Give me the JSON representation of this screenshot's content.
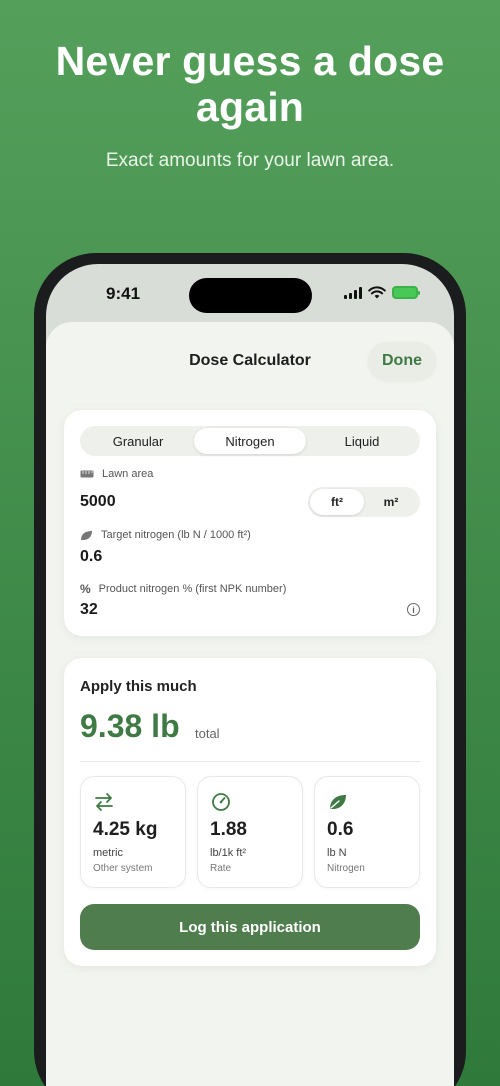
{
  "hero": {
    "title_line1": "Never guess a dose",
    "title_line2": "again",
    "subtitle": "Exact amounts for your lawn area."
  },
  "status_bar": {
    "time": "9:41",
    "icons": [
      "signal-icon",
      "wifi-icon",
      "battery-charging-icon"
    ]
  },
  "sheet": {
    "title": "Dose Calculator",
    "done_label": "Done"
  },
  "product_type": {
    "options": [
      "Granular",
      "Nitrogen",
      "Liquid"
    ],
    "selected": "Nitrogen"
  },
  "form": {
    "lawn_area": {
      "icon": "ruler-icon",
      "label": "Lawn area",
      "value": "5000",
      "units": [
        "ft²",
        "m²"
      ],
      "selected_unit": "ft²"
    },
    "target_nitrogen": {
      "icon": "leaf-icon",
      "label": "Target nitrogen (lb N / 1000 ft²)",
      "value": "0.6"
    },
    "product_nitrogen": {
      "icon": "percent-icon",
      "label": "Product nitrogen % (first NPK number)",
      "value": "32"
    }
  },
  "result": {
    "title": "Apply this much",
    "value": "9.38 lb",
    "unit": "total",
    "stats": [
      {
        "icon": "swap-arrows-icon",
        "value": "4.25 kg",
        "unit": "metric",
        "caption": "Other system"
      },
      {
        "icon": "gauge-icon",
        "value": "1.88",
        "unit": "lb/1k ft²",
        "caption": "Rate"
      },
      {
        "icon": "leaf-icon",
        "value": "0.6",
        "unit": "lb N",
        "caption": "Nitrogen"
      }
    ],
    "log_label": "Log this application"
  },
  "colors": {
    "accent": "#3f7a44",
    "button": "#4f7d4d",
    "background": "#4a9653"
  }
}
